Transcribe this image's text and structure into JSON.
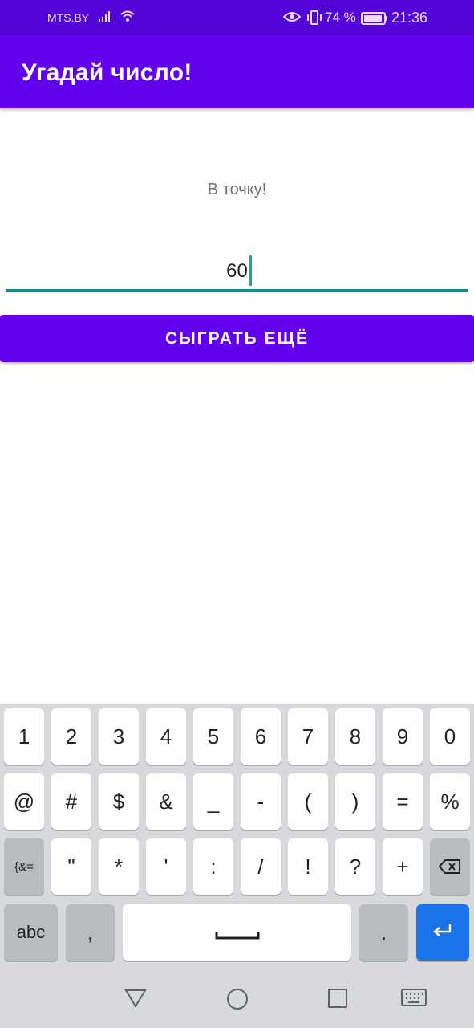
{
  "status_bar": {
    "carrier": "MTS.BY",
    "battery": "74 %",
    "time": "21:36"
  },
  "app_bar": {
    "title": "Угадай число!"
  },
  "main": {
    "result_text": "В точку!",
    "guess_value": "60",
    "play_again_label": "СЫГРАТЬ ЕЩЁ"
  },
  "keyboard": {
    "row1": [
      "1",
      "2",
      "3",
      "4",
      "5",
      "6",
      "7",
      "8",
      "9",
      "0"
    ],
    "row2": [
      "@",
      "#",
      "$",
      "&",
      "_",
      "-",
      "(",
      ")",
      "=",
      "%"
    ],
    "row3": [
      "{&=",
      "\"",
      "*",
      "'",
      ":",
      "/",
      "!",
      "?",
      "+"
    ],
    "abc_label": "abc",
    "comma_label": ",",
    "period_label": ".",
    "enter_color": "#1a73e8"
  },
  "colors": {
    "primary": "#6200ee",
    "status_bar": "#5303d8",
    "accent": "#148a89"
  }
}
